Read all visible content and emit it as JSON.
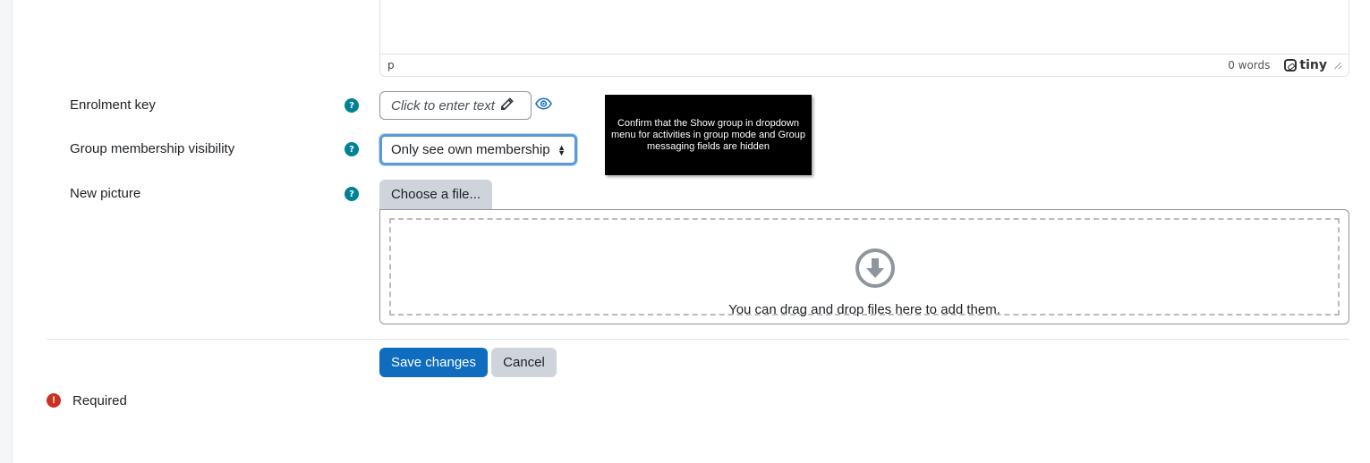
{
  "editor": {
    "path": "p",
    "word_count": "0 words",
    "brand": "tiny"
  },
  "fields": {
    "enrolment_key": {
      "label": "Enrolment key",
      "placeholder_text": "Click to enter text"
    },
    "group_visibility": {
      "label": "Group membership visibility",
      "selected": "Only see own membership"
    },
    "new_picture": {
      "label": "New picture",
      "choose_button": "Choose a file...",
      "dropzone_text": "You can drag and drop files here to add them."
    }
  },
  "tooltip": {
    "text": "Confirm that the Show group in dropdown menu for activities in group mode and Group messaging fields are hidden"
  },
  "actions": {
    "save_label": "Save changes",
    "cancel_label": "Cancel"
  },
  "footer": {
    "required_label": "Required"
  },
  "colors": {
    "help_icon": "#008196",
    "primary_button": "#0f6cbf",
    "secondary_button": "#ced4da",
    "required_icon": "#ca3120",
    "focus_ring": "#5b9bd5",
    "tooltip_bg": "#000000"
  },
  "icons": {
    "help": "question-circle",
    "edit": "pencil",
    "visibility": "eye",
    "upload": "arrow-circle-down",
    "required": "exclamation-circle"
  }
}
